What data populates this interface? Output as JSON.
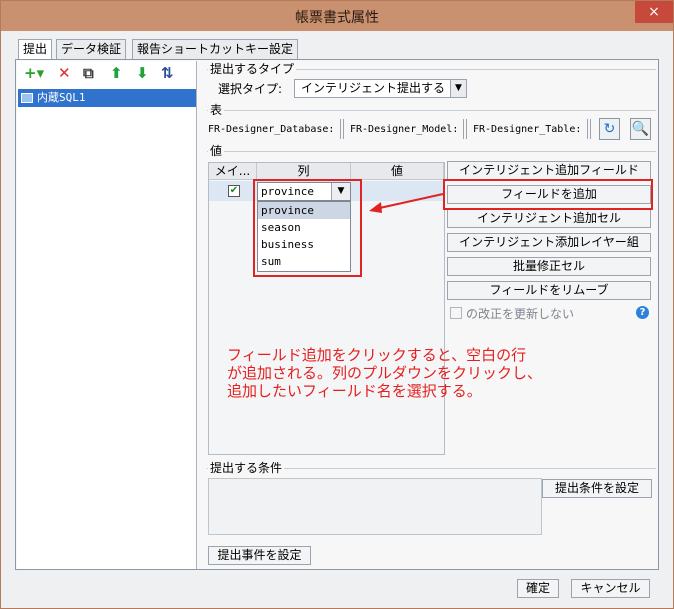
{
  "window": {
    "title": "帳票書式属性",
    "close_glyph": "×"
  },
  "tabs": [
    "提出",
    "データ検証",
    "報告ショートカットキー設定"
  ],
  "toolbar": {
    "icons": [
      {
        "name": "add-icon",
        "glyph": "+▾",
        "color": "#2ba02b"
      },
      {
        "name": "delete-icon",
        "glyph": "✕",
        "color": "#e02b2b"
      },
      {
        "name": "copy-icon",
        "glyph": "⧉",
        "color": "#3a3a3a"
      },
      {
        "name": "move-up-icon",
        "glyph": "⬆",
        "color": "#20a33a"
      },
      {
        "name": "move-down-icon",
        "glyph": "⬇",
        "color": "#20a33a"
      },
      {
        "name": "sort-icon",
        "glyph": "⇅",
        "color": "#2a4a9a"
      }
    ]
  },
  "tree": {
    "items": [
      {
        "label": "内蔵SQL1"
      }
    ]
  },
  "submit_type": {
    "legend": "提出するタイプ",
    "label": "選択タイプ:",
    "value": "インテリジェント提出する"
  },
  "table_section": {
    "legend": "表",
    "database_label": "FR-Designer_Database:",
    "model_label": "FR-Designer_Model:",
    "table_label": "FR-Designer_Table:",
    "refresh_icon": "refresh-icon",
    "preview_icon": "preview-icon"
  },
  "values_section": {
    "legend": "値",
    "columns": [
      "メイ...",
      "列",
      "値"
    ],
    "rows": [
      {
        "checked": true,
        "column_value": "province",
        "value": ""
      }
    ],
    "dropdown_options": [
      "province",
      "season",
      "business",
      "sum"
    ],
    "selected_option": "province"
  },
  "side_buttons": [
    "インテリジェント追加フィールド",
    "フィールドを追加",
    "インテリジェント追加セル",
    "インテリジェント添加レイヤー組",
    "批量修正セル",
    "フィールドをリムーブ"
  ],
  "update_checkbox": {
    "label": "の改正を更新しない",
    "checked": false
  },
  "annotation": {
    "lines": [
      "フィールド追加をクリックすると、空白の行",
      "が追加される。列のプルダウンをクリックし、",
      "追加したいフィールド名を選択する。"
    ],
    "color": "#e51f1f"
  },
  "conditions": {
    "legend": "提出する条件",
    "button": "提出条件を設定"
  },
  "submit_event_button": "提出事件を設定",
  "footer": {
    "ok": "確定",
    "cancel": "キャンセル"
  }
}
